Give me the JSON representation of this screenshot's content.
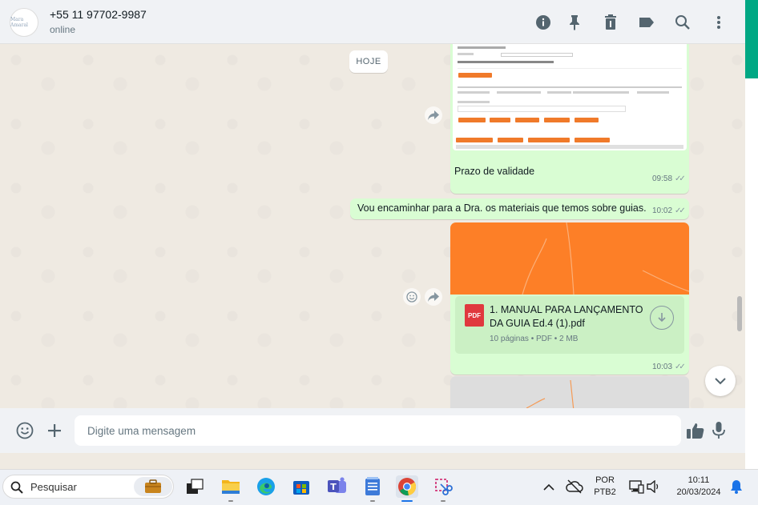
{
  "contact": {
    "name": "+55 11 97702-9987",
    "status": "online",
    "avatar_text": "Mara Amaral"
  },
  "chat": {
    "day_chip": "HOJE",
    "image_message": {
      "caption": "Prazo de validade",
      "time": "09:58"
    },
    "text_message": {
      "text": "Vou encaminhar para a Dra. os materiais que temos sobre guias.",
      "time": "10:02"
    },
    "document_message": {
      "file_type_badge": "PDF",
      "file_name": "1. MANUAL PARA LANÇAMENTO DA GUIA Ed.4 (1).pdf",
      "details": "10 páginas • PDF • 2 MB",
      "time": "10:03"
    }
  },
  "composer": {
    "placeholder": "Digite uma mensagem"
  },
  "taskbar": {
    "search_placeholder": "Pesquisar",
    "language": "POR",
    "layout": "PTB2",
    "time": "10:11",
    "date": "20/03/2024"
  },
  "colors": {
    "header_bg": "#f0f2f5",
    "chat_bg": "#efeae2",
    "outgoing_bubble": "#d9fdd3",
    "accent_green": "#00a884",
    "doc_thumb_orange": "#fd7f27",
    "pdf_red": "#e0383e"
  },
  "icons": {
    "header": [
      "info-icon",
      "pin-icon",
      "trash-icon",
      "label-icon",
      "search-icon",
      "menu-icon"
    ],
    "composer": [
      "emoji-icon",
      "plus-icon",
      "thumbs-up-icon",
      "mic-icon"
    ]
  }
}
